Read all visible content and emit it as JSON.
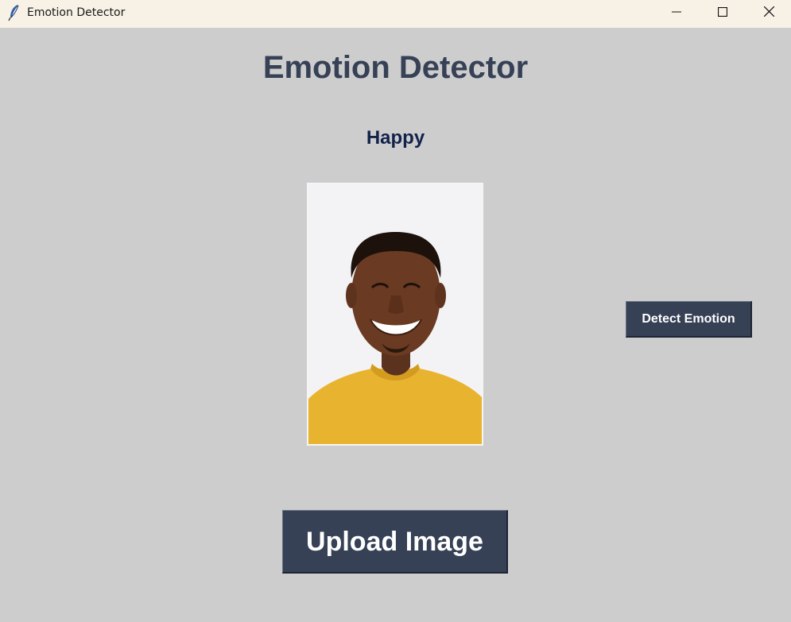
{
  "window": {
    "title": "Emotion Detector",
    "controls": [
      "minimize",
      "maximize",
      "close"
    ]
  },
  "app": {
    "heading": "Emotion Detector",
    "result": "Happy",
    "image_alt": "Uploaded photo of a smiling man in a yellow sweater",
    "detect_button": "Detect Emotion",
    "upload_button": "Upload Image"
  },
  "colors": {
    "background": "#cdcdcd",
    "titlebar": "#f8f1e6",
    "heading": "#364156",
    "result": "#12224a",
    "button_bg": "#364156",
    "button_text": "#ffffff"
  },
  "icons": {
    "app": "feather-icon",
    "minimize": "minimize-icon",
    "maximize": "maximize-icon",
    "close": "close-icon"
  }
}
